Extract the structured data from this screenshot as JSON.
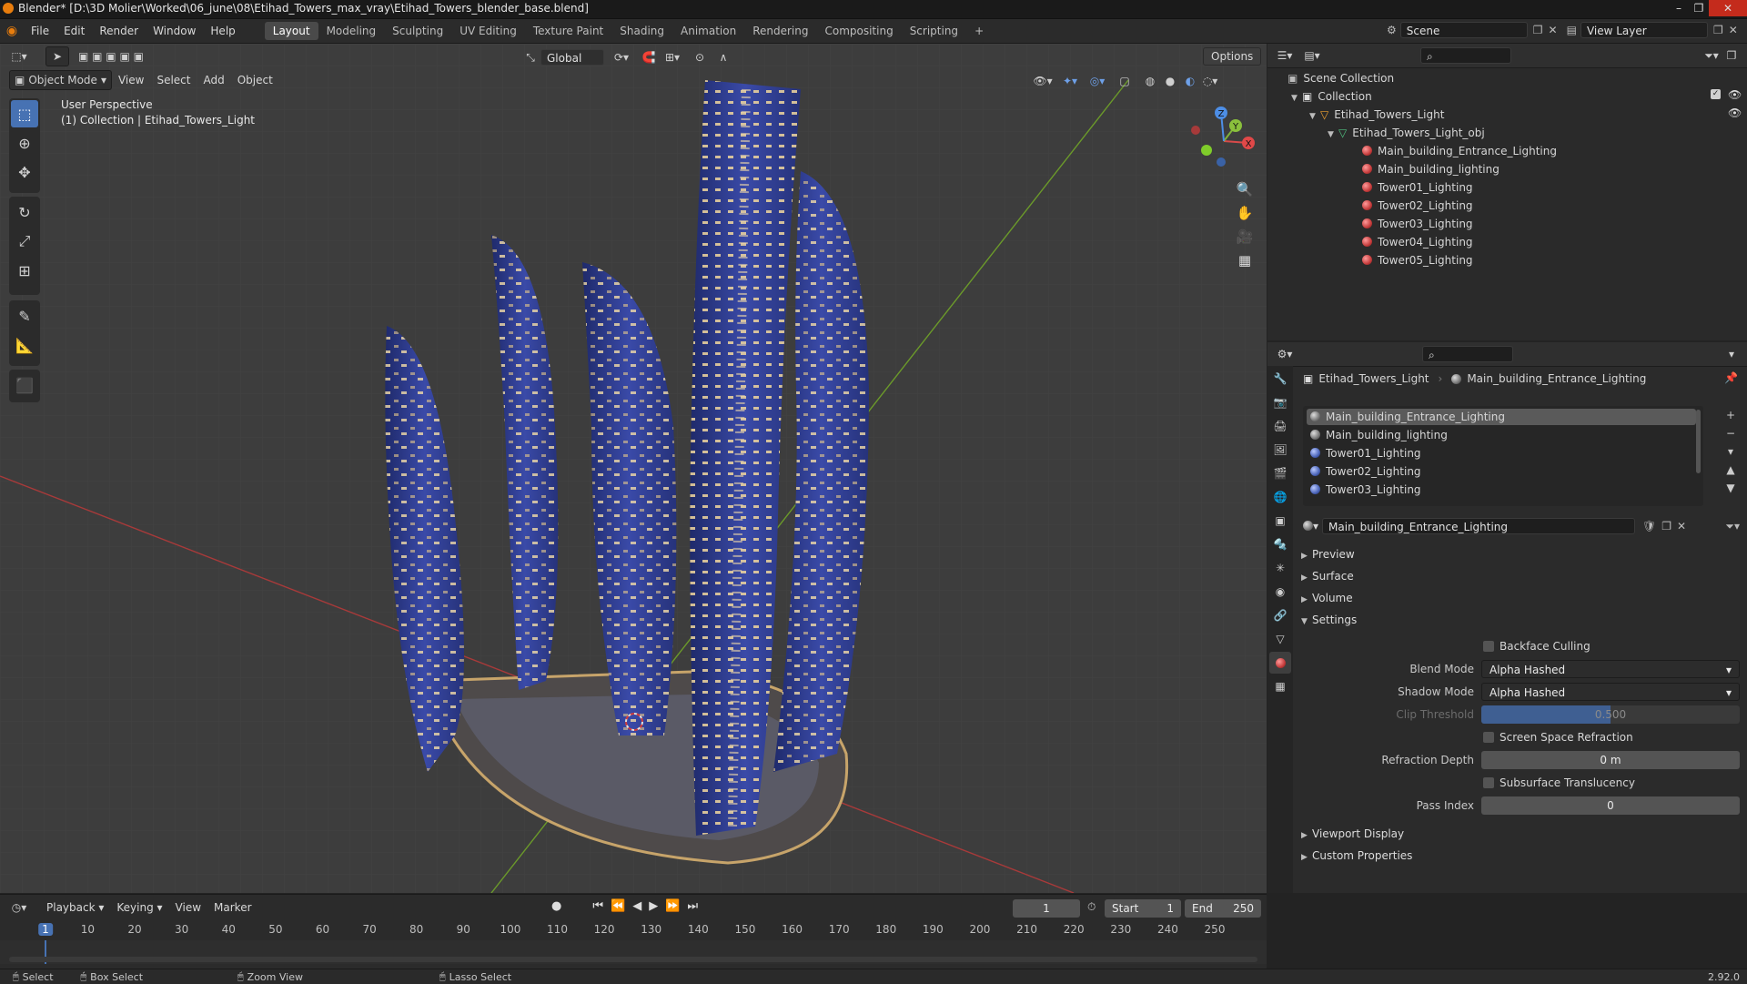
{
  "window": {
    "title": "Blender* [D:\\3D Molier\\Worked\\06_june\\08\\Etihad_Towers_max_vray\\Etihad_Towers_blender_base.blend]"
  },
  "menu": [
    "File",
    "Edit",
    "Render",
    "Window",
    "Help"
  ],
  "workspaces": [
    "Layout",
    "Modeling",
    "Sculpting",
    "UV Editing",
    "Texture Paint",
    "Shading",
    "Animation",
    "Rendering",
    "Compositing",
    "Scripting"
  ],
  "active_workspace": "Layout",
  "scene": {
    "name": "Scene",
    "view_layer": "View Layer"
  },
  "viewport": {
    "transform_orientation": "Global",
    "options_label": "Options",
    "mode": "Object Mode",
    "menus": [
      "View",
      "Select",
      "Add",
      "Object"
    ],
    "overlay_title": "User Perspective",
    "overlay_subtitle": "(1) Collection | Etihad_Towers_Light",
    "gizmo": {
      "x": "X",
      "y": "Y",
      "z": "Z"
    }
  },
  "outliner": {
    "scene_collection": "Scene Collection",
    "collection": "Collection",
    "object": "Etihad_Towers_Light",
    "mesh": "Etihad_Towers_Light_obj",
    "materials": [
      "Main_building_Entrance_Lighting",
      "Main_building_lighting",
      "Tower01_Lighting",
      "Tower02_Lighting",
      "Tower03_Lighting",
      "Tower04_Lighting",
      "Tower05_Lighting"
    ]
  },
  "properties": {
    "breadcrumb_object": "Etihad_Towers_Light",
    "breadcrumb_material": "Main_building_Entrance_Lighting",
    "slots": [
      "Main_building_Entrance_Lighting",
      "Main_building_lighting",
      "Tower01_Lighting",
      "Tower02_Lighting",
      "Tower03_Lighting"
    ],
    "active_material": "Main_building_Entrance_Lighting",
    "sections": {
      "preview": "Preview",
      "surface": "Surface",
      "volume": "Volume",
      "settings": "Settings",
      "viewport_display": "Viewport Display",
      "custom_properties": "Custom Properties"
    },
    "settings": {
      "backface_culling": "Backface Culling",
      "blend_mode_label": "Blend Mode",
      "blend_mode": "Alpha Hashed",
      "shadow_mode_label": "Shadow Mode",
      "shadow_mode": "Alpha Hashed",
      "clip_threshold_label": "Clip Threshold",
      "clip_threshold": "0.500",
      "ssr": "Screen Space Refraction",
      "refraction_depth_label": "Refraction Depth",
      "refraction_depth": "0 m",
      "subsurface": "Subsurface Translucency",
      "pass_index_label": "Pass Index",
      "pass_index": "0"
    }
  },
  "timeline": {
    "menus": [
      "Playback",
      "Keying",
      "View",
      "Marker"
    ],
    "current_frame": "1",
    "start_label": "Start",
    "start": "1",
    "end_label": "End",
    "end": "250",
    "ticks": [
      "1",
      "10",
      "20",
      "30",
      "40",
      "50",
      "60",
      "70",
      "80",
      "90",
      "100",
      "110",
      "120",
      "130",
      "140",
      "150",
      "160",
      "170",
      "180",
      "190",
      "200",
      "210",
      "220",
      "230",
      "240",
      "250"
    ]
  },
  "status": {
    "select": "Select",
    "box_select": "Box Select",
    "zoom_view": "Zoom View",
    "lasso_select": "Lasso Select",
    "version": "2.92.0"
  },
  "colors": {
    "accent": "#4772b3",
    "building": "#2e3a8a",
    "window_light": "#f4d7a0"
  }
}
